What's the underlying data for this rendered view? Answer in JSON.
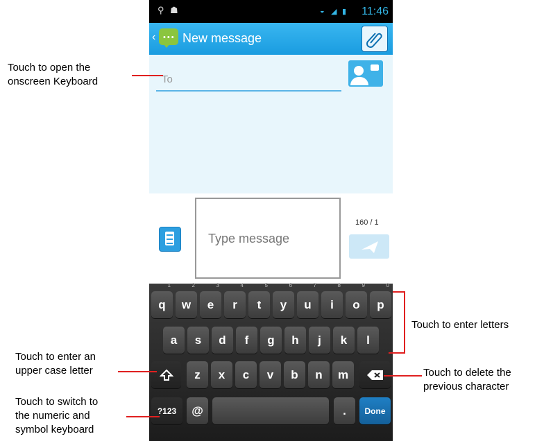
{
  "status_bar": {
    "time": "11:46"
  },
  "action_bar": {
    "title": "New message"
  },
  "compose": {
    "to_placeholder": "To"
  },
  "message": {
    "placeholder": "Type message",
    "counter": "160 / 1"
  },
  "keyboard": {
    "row1": [
      {
        "label": "q",
        "hint": "1"
      },
      {
        "label": "w",
        "hint": "2"
      },
      {
        "label": "e",
        "hint": "3"
      },
      {
        "label": "r",
        "hint": "4"
      },
      {
        "label": "t",
        "hint": "5"
      },
      {
        "label": "y",
        "hint": "6"
      },
      {
        "label": "u",
        "hint": "7"
      },
      {
        "label": "i",
        "hint": "8"
      },
      {
        "label": "o",
        "hint": "9"
      },
      {
        "label": "p",
        "hint": "0"
      }
    ],
    "row2": [
      "a",
      "s",
      "d",
      "f",
      "g",
      "h",
      "j",
      "k",
      "l"
    ],
    "row3": [
      "z",
      "x",
      "c",
      "v",
      "b",
      "n",
      "m"
    ],
    "symbols_label": "?123",
    "at_label": "@",
    "period_label": ".",
    "done_label": "Done"
  },
  "callouts": {
    "open_keyboard": [
      "Touch to open the",
      "onscreen Keyboard"
    ],
    "enter_letters": "Touch to enter letters",
    "upper_case": [
      "Touch to enter an",
      "upper case letter"
    ],
    "delete_char": [
      "Touch to delete the",
      "previous character"
    ],
    "switch_symbols": [
      "Touch to switch to",
      "the numeric and",
      "symbol keyboard"
    ]
  },
  "colors": {
    "accent": "#33b5e5",
    "callout_line": "#e02020"
  }
}
